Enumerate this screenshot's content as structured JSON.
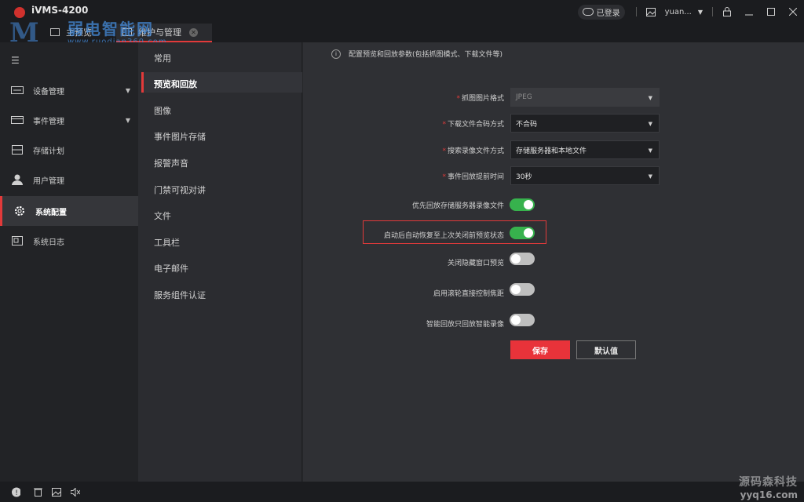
{
  "app": {
    "title": "iVMS-4200"
  },
  "watermark": {
    "site_name": "弱电智能网",
    "url": "www.ruodian360.com"
  },
  "tabs": [
    {
      "label": "主预览",
      "active": false
    },
    {
      "label": "维护与管理",
      "active": true
    }
  ],
  "top_right": {
    "login_status": "已登录",
    "user": "yuan..."
  },
  "sidebar": {
    "items": [
      {
        "label": "设备管理",
        "icon": "device-icon",
        "has_arrow": true,
        "active": false
      },
      {
        "label": "事件管理",
        "icon": "event-icon",
        "has_arrow": true,
        "active": false
      },
      {
        "label": "存储计划",
        "icon": "storage-icon",
        "has_arrow": false,
        "active": false
      },
      {
        "label": "用户管理",
        "icon": "user-icon",
        "has_arrow": false,
        "active": false
      },
      {
        "label": "系统配置",
        "icon": "gear-icon",
        "has_arrow": false,
        "active": true
      },
      {
        "label": "系统日志",
        "icon": "log-icon",
        "has_arrow": false,
        "active": false
      }
    ]
  },
  "subnav": {
    "items": [
      {
        "label": "常用"
      },
      {
        "label": "预览和回放"
      },
      {
        "label": "图像"
      },
      {
        "label": "事件图片存储"
      },
      {
        "label": "报警声音"
      },
      {
        "label": "门禁可视对讲"
      },
      {
        "label": "文件"
      },
      {
        "label": "工具栏"
      },
      {
        "label": "电子邮件"
      },
      {
        "label": "服务组件认证"
      }
    ],
    "active_index": 1
  },
  "main": {
    "info": "配置预览和回放参数(包括抓图模式、下载文件等)",
    "fields": [
      {
        "label": "抓图图片格式",
        "required": true,
        "value": "JPEG",
        "disabled": true
      },
      {
        "label": "下载文件合码方式",
        "required": true,
        "value": "不合码",
        "disabled": false
      },
      {
        "label": "搜索录像文件方式",
        "required": true,
        "value": "存储服务器和本地文件",
        "disabled": false
      },
      {
        "label": "事件回放提前时间",
        "required": true,
        "value": "30秒",
        "disabled": false
      }
    ],
    "toggles": [
      {
        "label": "优先回放存储服务器录像文件",
        "on": true
      },
      {
        "label": "启动后自动恢复至上次关闭前预览状态",
        "on": true
      },
      {
        "label": "关闭隐藏窗口预览",
        "on": false
      },
      {
        "label": "启用滚轮直接控制焦距",
        "on": false
      },
      {
        "label": "智能回放只回放智能录像",
        "on": false
      }
    ],
    "save_label": "保存",
    "default_label": "默认值"
  },
  "bottom_watermark": {
    "brand": "源码森科技",
    "url": "yyq16.com"
  },
  "colors": {
    "accent": "#e23a3a",
    "toggle_on": "#37b24d",
    "save_button": "#e8333a"
  }
}
